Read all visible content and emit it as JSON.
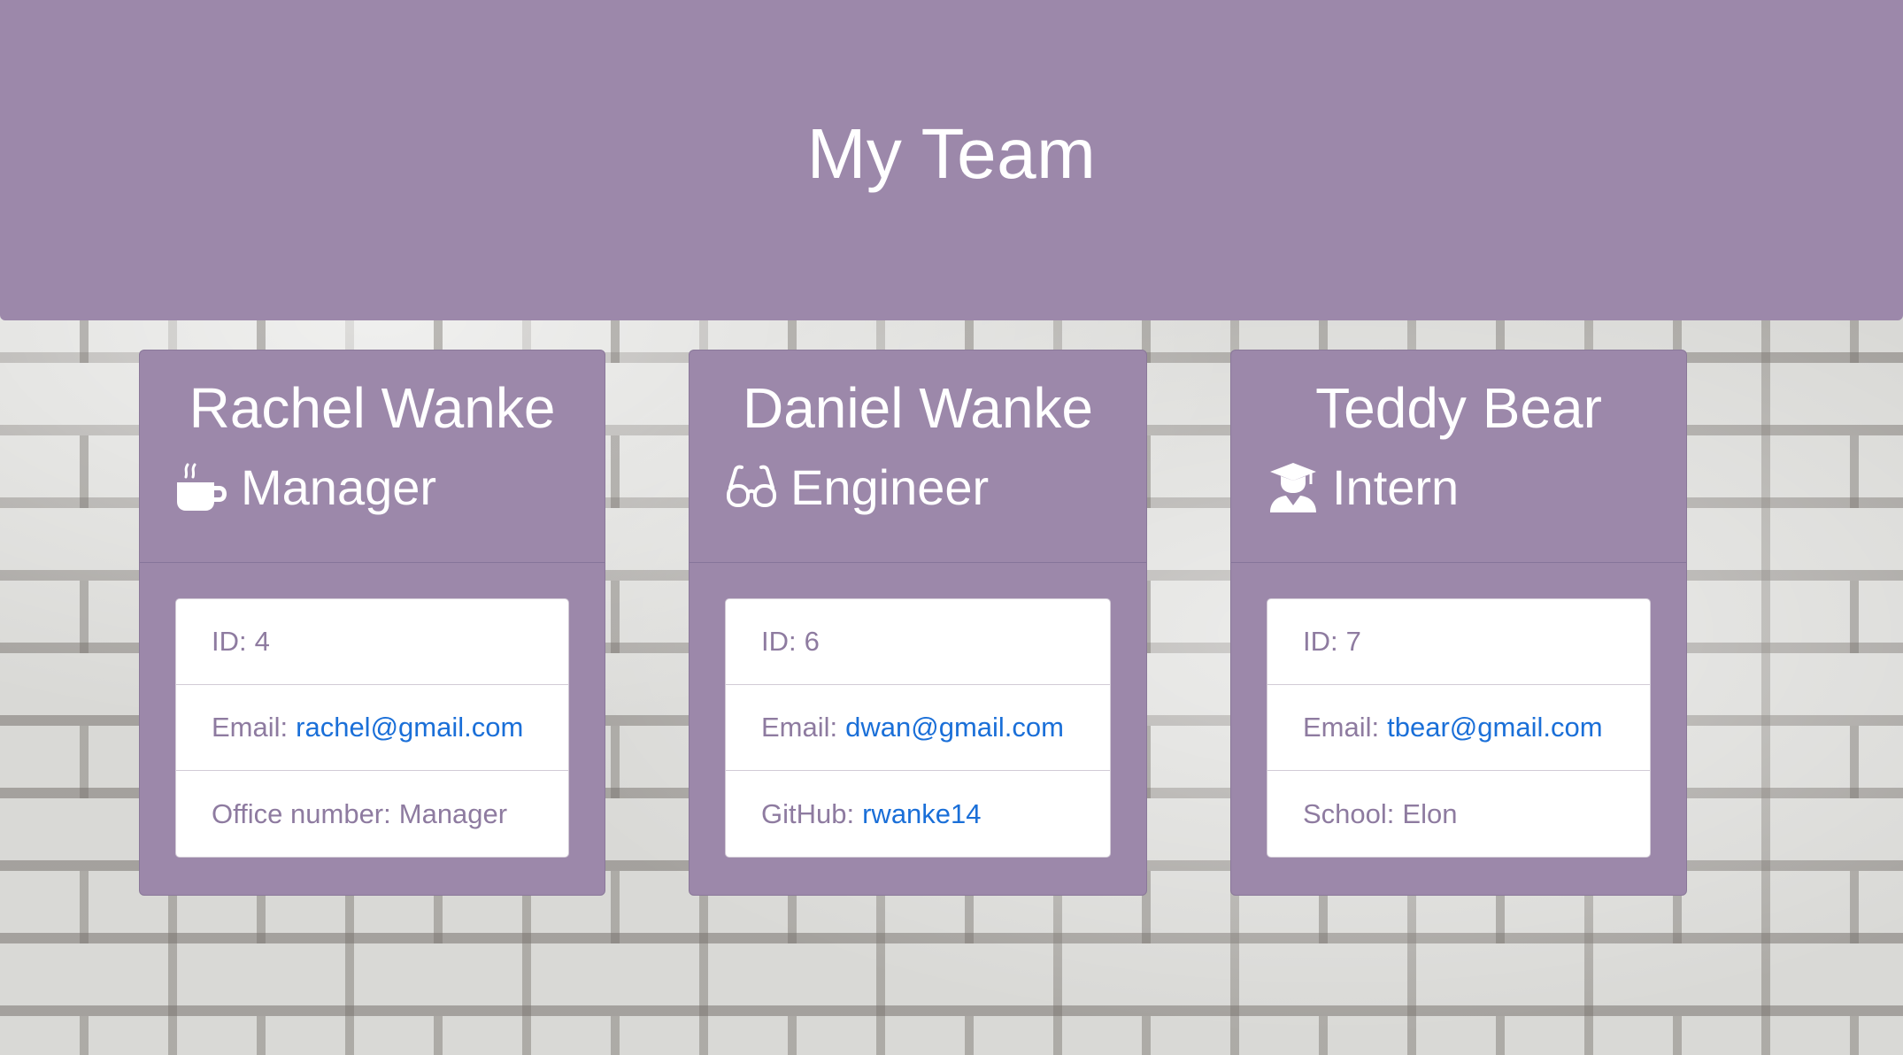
{
  "header": {
    "title": "My Team"
  },
  "colors": {
    "header_bg": "#9c88aa",
    "card_bg": "#9c88aa",
    "link": "#1a6fd8",
    "item_text": "#8e7ba0"
  },
  "team": [
    {
      "name": "Rachel Wanke",
      "role": "Manager",
      "role_icon": "coffee-mug-icon",
      "id_label": "ID:",
      "id_value": "4",
      "email_label": "Email:",
      "email": "rachel@gmail.com",
      "extra_label": "Office number:",
      "extra_value": "Manager"
    },
    {
      "name": "Daniel Wanke",
      "role": "Engineer",
      "role_icon": "glasses-icon",
      "id_label": "ID:",
      "id_value": "6",
      "email_label": "Email:",
      "email": "dwan@gmail.com",
      "extra_label": "GitHub:",
      "extra_value": "rwanke14"
    },
    {
      "name": "Teddy Bear",
      "role": "Intern",
      "role_icon": "graduate-icon",
      "id_label": "ID:",
      "id_value": "7",
      "email_label": "Email:",
      "email": "tbear@gmail.com",
      "extra_label": "School:",
      "extra_value": "Elon"
    }
  ]
}
